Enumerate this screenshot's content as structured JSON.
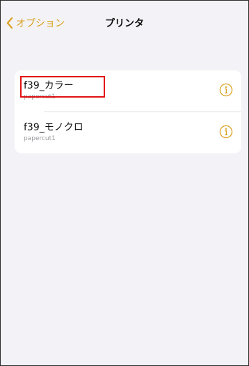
{
  "nav": {
    "back_label": "オプション",
    "title": "プリンタ"
  },
  "printers": [
    {
      "name": "f39_カラー",
      "server": "papercut1"
    },
    {
      "name": "f39_モノクロ",
      "server": "papercut1"
    }
  ],
  "colors": {
    "accent": "#d9a11f",
    "background": "#f2f2f7",
    "highlight": "#e01010"
  },
  "icons": {
    "back": "chevron-left-icon",
    "info": "info-icon"
  }
}
